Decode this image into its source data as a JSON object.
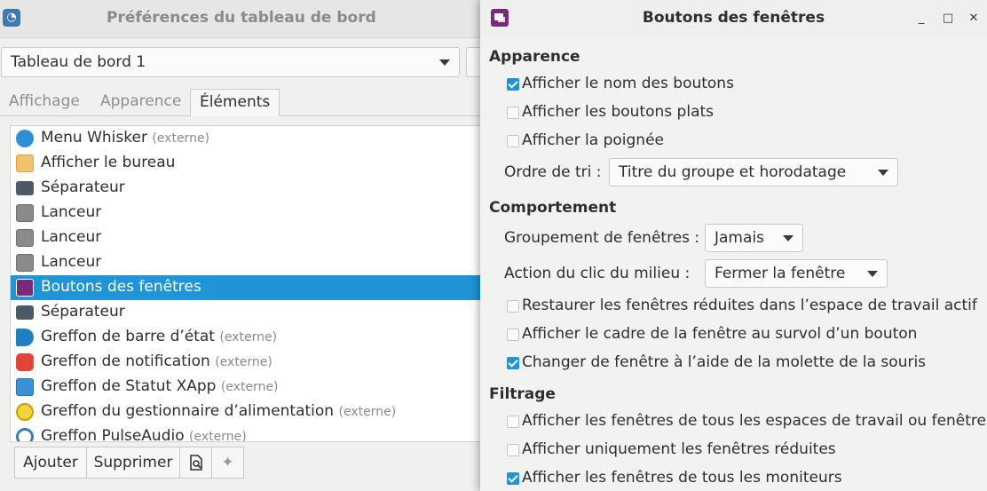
{
  "prefs_window": {
    "title": "Préférences du tableau de bord",
    "panel_select": {
      "value": "Tableau de bord 1"
    },
    "tabs": [
      {
        "label": "Affichage",
        "active": false
      },
      {
        "label": "Apparence",
        "active": false
      },
      {
        "label": "Éléments",
        "active": true
      }
    ],
    "items": [
      {
        "label": "Menu Whisker",
        "suffix": "(externe)",
        "icon": "whisker-menu-icon",
        "selected": false
      },
      {
        "label": "Afficher le bureau",
        "suffix": "",
        "icon": "show-desktop-icon",
        "selected": false
      },
      {
        "label": "Séparateur",
        "suffix": "",
        "icon": "separator-icon",
        "selected": false
      },
      {
        "label": "Lanceur",
        "suffix": "",
        "icon": "launcher-icon",
        "selected": false
      },
      {
        "label": "Lanceur",
        "suffix": "",
        "icon": "launcher-icon",
        "selected": false
      },
      {
        "label": "Lanceur",
        "suffix": "",
        "icon": "launcher-icon",
        "selected": false
      },
      {
        "label": "Boutons des fenêtres",
        "suffix": "",
        "icon": "window-buttons-icon",
        "selected": true
      },
      {
        "label": "Séparateur",
        "suffix": "",
        "icon": "separator-icon",
        "selected": false
      },
      {
        "label": "Greffon de barre d’état",
        "suffix": "(externe)",
        "icon": "megaphone-icon",
        "selected": false
      },
      {
        "label": "Greffon de notification",
        "suffix": "(externe)",
        "icon": "notification-bell-icon",
        "selected": false
      },
      {
        "label": "Greffon de Statut XApp",
        "suffix": "(externe)",
        "icon": "xapp-status-icon",
        "selected": false
      },
      {
        "label": "Greffon du gestionnaire d’alimentation",
        "suffix": "(externe)",
        "icon": "power-manager-icon",
        "selected": false
      },
      {
        "label": "Greffon PulseAudio",
        "suffix": "(externe)",
        "icon": "pulseaudio-icon",
        "selected": false
      }
    ],
    "toolbar": {
      "add_label": "Ajouter",
      "remove_label": "Supprimer"
    }
  },
  "dialog": {
    "title": "Boutons des fenêtres",
    "controls": {
      "minimize": "_",
      "maximize": "□",
      "close": "✕"
    },
    "appearance": {
      "heading": "Apparence",
      "show_names": {
        "label": "Afficher le nom des boutons",
        "checked": true
      },
      "flat_buttons": {
        "label": "Afficher les boutons plats",
        "checked": false
      },
      "show_handle": {
        "label": "Afficher la poignée",
        "checked": false
      },
      "sort_order": {
        "label": "Ordre de tri :",
        "value": "Titre du groupe et horodatage"
      }
    },
    "behaviour": {
      "heading": "Comportement",
      "grouping": {
        "label": "Groupement de fenêtres :",
        "value": "Jamais"
      },
      "middle_click": {
        "label": "Action du clic du milieu :",
        "value": "Fermer la fenêtre"
      },
      "restore_minimized": {
        "label": "Restaurer les fenêtres réduites dans l’espace de travail actif",
        "checked": false
      },
      "hover_frame": {
        "label": "Afficher le cadre de la fenêtre au survol d’un bouton",
        "checked": false
      },
      "mouse_wheel": {
        "label": "Changer de fenêtre à l’aide de la molette de la souris",
        "checked": true
      }
    },
    "filtering": {
      "heading": "Filtrage",
      "all_workspaces": {
        "label": "Afficher les fenêtres de tous les espaces de travail ou fenêtres",
        "checked": false
      },
      "only_minimized": {
        "label": "Afficher uniquement les fenêtres réduites",
        "checked": false
      },
      "all_monitors": {
        "label": "Afficher les fenêtres de tous les moniteurs",
        "checked": true
      }
    }
  }
}
